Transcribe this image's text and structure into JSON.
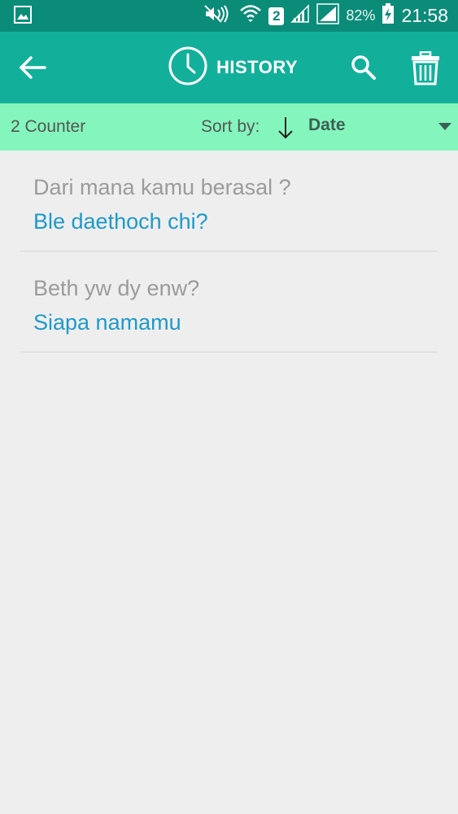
{
  "status_bar": {
    "battery": "82%",
    "time": "21:58",
    "sim": "2",
    "icons": [
      "gallery-icon",
      "mute-icon",
      "wifi-icon",
      "sim-badge-icon",
      "signal-icon",
      "signal-full-icon",
      "charging-icon"
    ]
  },
  "app_bar": {
    "title": "HISTORY",
    "icons": [
      "back-arrow-icon",
      "clock-icon",
      "search-icon",
      "trash-icon"
    ],
    "color": "#12b09a"
  },
  "sort_bar": {
    "counter": "2 Counter",
    "sort_label": "Sort by:",
    "sort_value": "Date",
    "color": "#84f6bd"
  },
  "history": [
    {
      "source": "Dari mana kamu berasal ?",
      "translation": "Ble daethoch chi?"
    },
    {
      "source": "Beth yw dy enw?",
      "translation": "Siapa namamu"
    }
  ]
}
